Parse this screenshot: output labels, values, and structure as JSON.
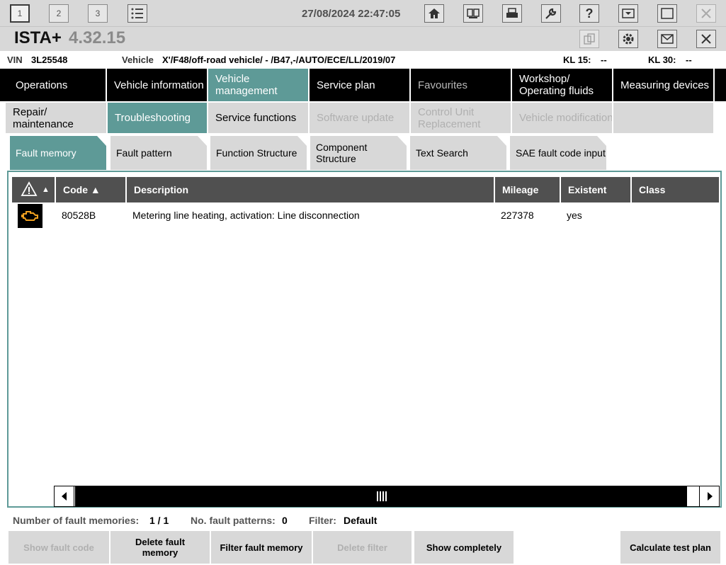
{
  "titlebar": {
    "window_buttons": [
      "1",
      "2",
      "3"
    ],
    "datetime": "27/08/2024 22:47:05",
    "icons": [
      "list-icon",
      "home-icon",
      "keyboard-icon",
      "print-icon",
      "wrench-icon",
      "help-icon",
      "minimize-icon",
      "maximize-icon",
      "close-icon"
    ]
  },
  "app": {
    "title": "ISTA+",
    "version": "4.32.15",
    "icons": [
      "copy-icon",
      "gear-icon",
      "mail-icon",
      "close-icon"
    ]
  },
  "info": {
    "vin_label": "VIN",
    "vin": "3L25548",
    "vehicle_label": "Vehicle",
    "vehicle": "X'/F48/off-road vehicle/ - /B47,-/AUTO/ECE/LL/2019/07",
    "kl15_label": "KL 15:",
    "kl15": "--",
    "kl30_label": "KL 30:",
    "kl30": "--"
  },
  "main_nav": [
    {
      "label": "Operations"
    },
    {
      "label": "Vehicle information"
    },
    {
      "label": "Vehicle management",
      "active": true
    },
    {
      "label": "Service plan"
    },
    {
      "label": "Favourites",
      "dim": true
    },
    {
      "label": "Workshop/ Operating fluids"
    },
    {
      "label": "Measuring devices"
    }
  ],
  "sub_nav": [
    {
      "label": "Repair/ maintenance"
    },
    {
      "label": "Troubleshooting",
      "active": true
    },
    {
      "label": "Service functions"
    },
    {
      "label": "Software update",
      "disabled": true
    },
    {
      "label": "Control Unit Replacement",
      "disabled": true
    },
    {
      "label": "Vehicle modification",
      "disabled": true
    }
  ],
  "function_tabs": [
    {
      "label": "Fault memory",
      "active": true
    },
    {
      "label": "Fault pattern"
    },
    {
      "label": "Function Structure"
    },
    {
      "label": "Component Structure"
    },
    {
      "label": "Text Search"
    },
    {
      "label": "SAE fault code input"
    }
  ],
  "table": {
    "headers": {
      "warning_sort": "▲",
      "code": "Code ▲",
      "description": "Description",
      "mileage": "Mileage",
      "existent": "Existent",
      "class": "Class"
    },
    "rows": [
      {
        "icon": "engine-warning-icon",
        "code": "80528B",
        "description": "Metering line heating, activation: Line disconnection",
        "mileage": "227378",
        "existent": "yes",
        "class": ""
      }
    ]
  },
  "status": {
    "fault_memories_label": "Number of fault memories:",
    "fault_memories": "1 / 1",
    "fault_patterns_label": "No. fault patterns:",
    "fault_patterns": "0",
    "filter_label": "Filter:",
    "filter": "Default"
  },
  "buttons": {
    "show_fault_code": "Show fault code",
    "delete_fault_memory": "Delete fault memory",
    "filter_fault_memory": "Filter fault memory",
    "delete_filter": "Delete filter",
    "show_completely": "Show completely",
    "calculate_test_plan": "Calculate test plan"
  },
  "colors": {
    "accent": "#5e9a97",
    "nav_bg": "#000000",
    "header_bg": "#505050",
    "warning_orange": "#f0a020"
  }
}
